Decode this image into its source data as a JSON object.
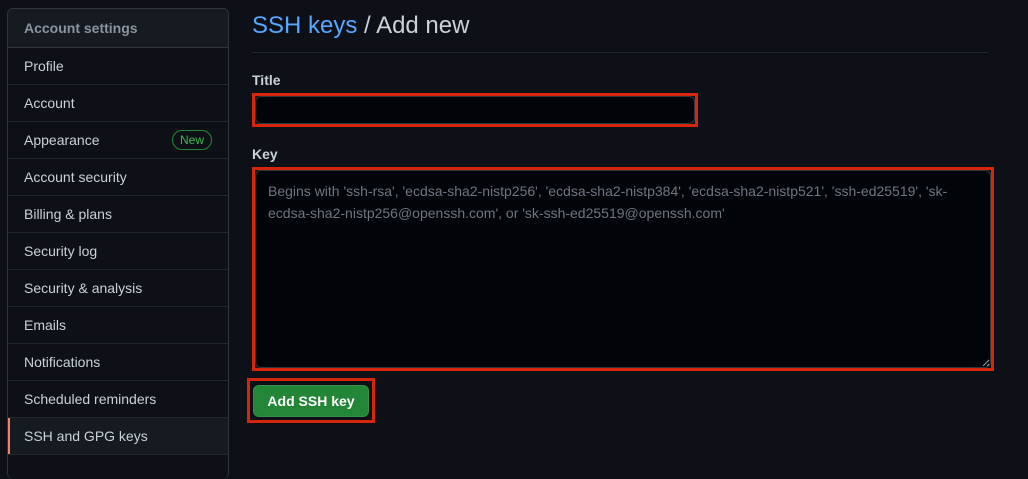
{
  "sidebar": {
    "header": "Account settings",
    "items": [
      {
        "label": "Profile"
      },
      {
        "label": "Account"
      },
      {
        "label": "Appearance",
        "badge": "New"
      },
      {
        "label": "Account security"
      },
      {
        "label": "Billing & plans"
      },
      {
        "label": "Security log"
      },
      {
        "label": "Security & analysis"
      },
      {
        "label": "Emails"
      },
      {
        "label": "Notifications"
      },
      {
        "label": "Scheduled reminders"
      },
      {
        "label": "SSH and GPG keys",
        "selected": true
      }
    ]
  },
  "main": {
    "breadcrumb_link": "SSH keys",
    "breadcrumb_sep": " / ",
    "breadcrumb_current": "Add new",
    "title_label": "Title",
    "title_value": "",
    "key_label": "Key",
    "key_value": "",
    "key_placeholder": "Begins with 'ssh-rsa', 'ecdsa-sha2-nistp256', 'ecdsa-sha2-nistp384', 'ecdsa-sha2-nistp521', 'ssh-ed25519', 'sk-ecdsa-sha2-nistp256@openssh.com', or 'sk-ssh-ed25519@openssh.com'",
    "submit_label": "Add SSH key"
  },
  "colors": {
    "background": "#0d1117",
    "link": "#58a6ff",
    "primary_button": "#238636",
    "highlight_box": "#d7260e",
    "selected_marker": "#f78166"
  }
}
